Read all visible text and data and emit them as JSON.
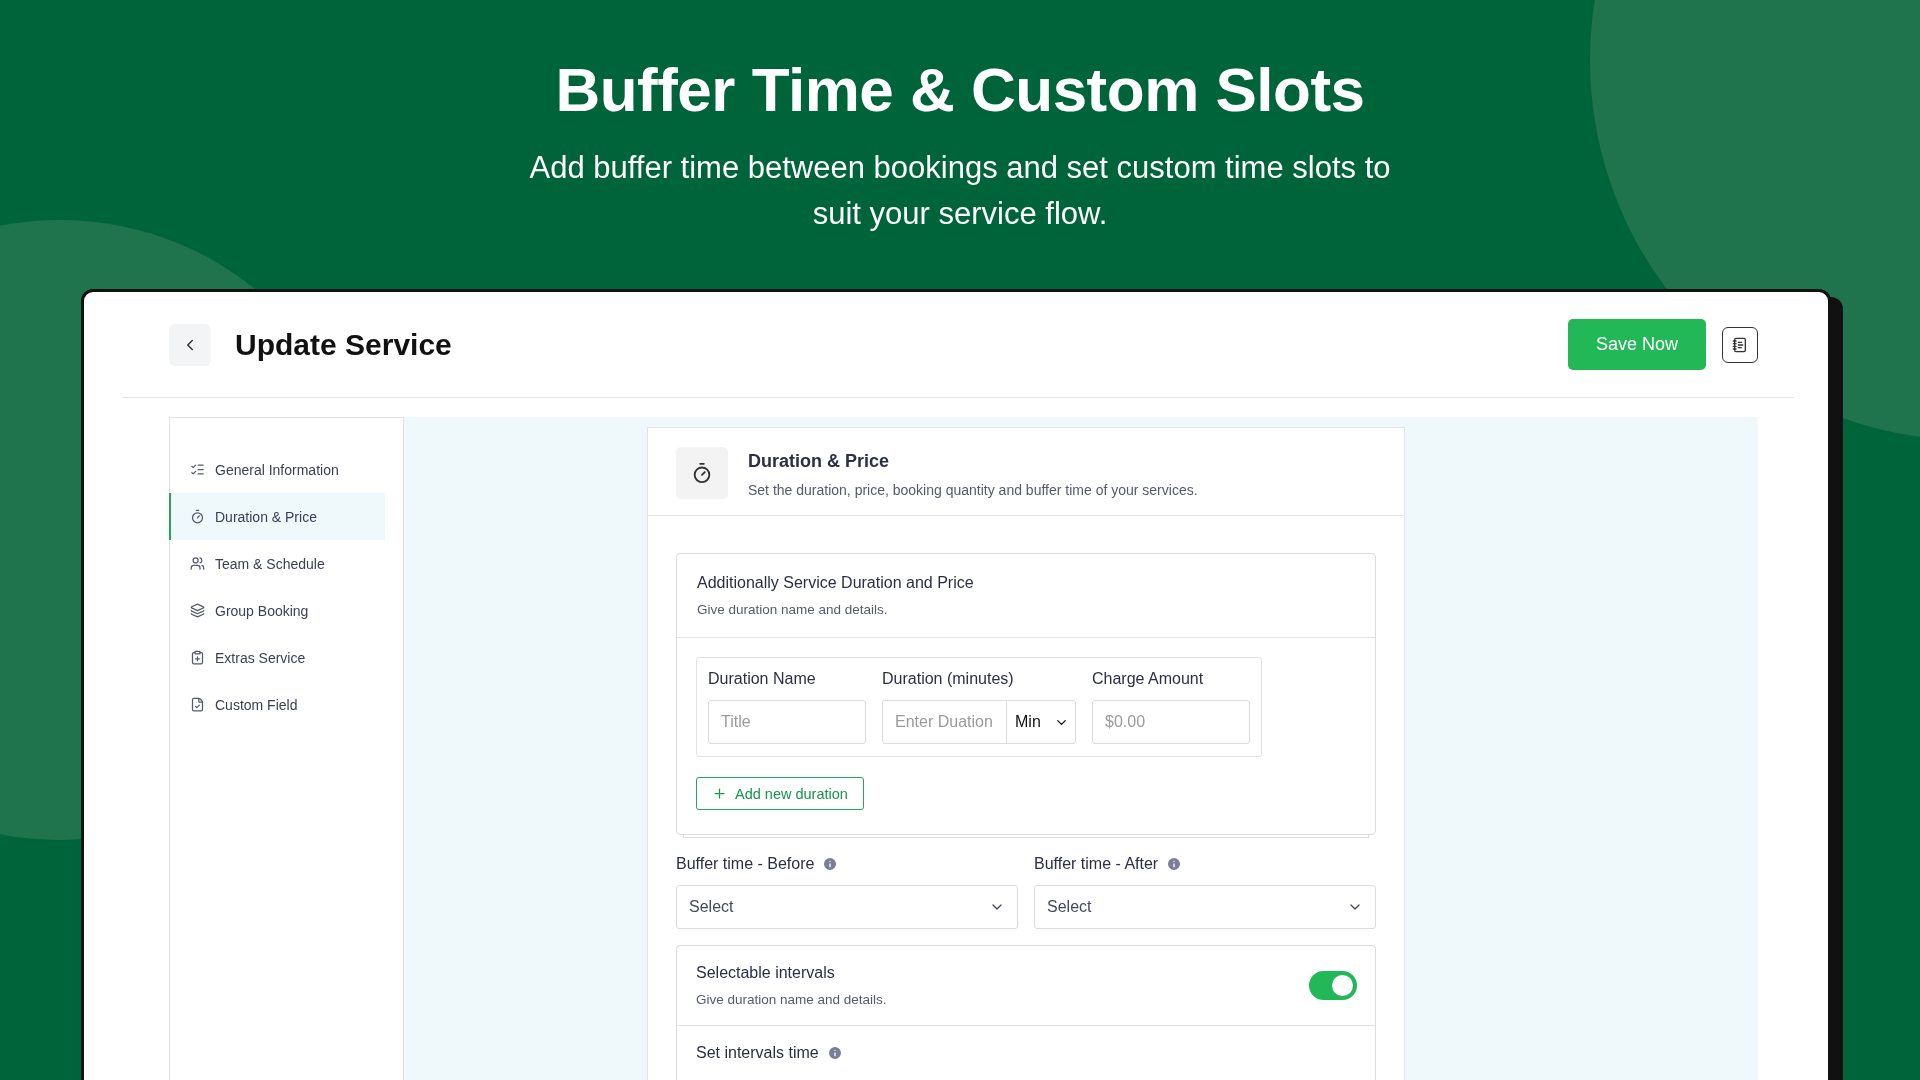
{
  "hero": {
    "title": "Buffer Time & Custom Slots",
    "subtitle": "Add buffer time between bookings and set custom time slots to suit your service flow."
  },
  "header": {
    "title": "Update Service",
    "save_button": "Save Now"
  },
  "sidebar": {
    "items": [
      {
        "kind": "list",
        "label": "General Information",
        "selected": false
      },
      {
        "kind": "timer",
        "label": "Duration & Price",
        "selected": true
      },
      {
        "kind": "team",
        "label": "Team & Schedule",
        "selected": false
      },
      {
        "kind": "layers",
        "label": "Group Booking",
        "selected": false
      },
      {
        "kind": "extras",
        "label": "Extras Service",
        "selected": false
      },
      {
        "kind": "custom",
        "label": "Custom Field",
        "selected": false
      }
    ]
  },
  "section": {
    "title": "Duration & Price",
    "description": "Set the duration, price, booking quantity and buffer time of your services.",
    "additional": {
      "title": "Additionally Service Duration and Price",
      "description": "Give duration name and details.",
      "fields": [
        {
          "label": "Duration Name",
          "placeholder": "Title"
        },
        {
          "label": "Duration (minutes)",
          "placeholder": "Enter Duation",
          "unit": "Min"
        },
        {
          "label": "Charge Amount",
          "placeholder": "$0.00"
        }
      ],
      "add_button": "Add new duration"
    },
    "buffers": [
      {
        "label": "Buffer time - Before",
        "value": "Select"
      },
      {
        "label": "Buffer time - After",
        "value": "Select"
      }
    ],
    "intervals": {
      "title": "Selectable intervals",
      "description": "Give duration name and details.",
      "on": true,
      "time_label": "Set intervals time"
    }
  }
}
